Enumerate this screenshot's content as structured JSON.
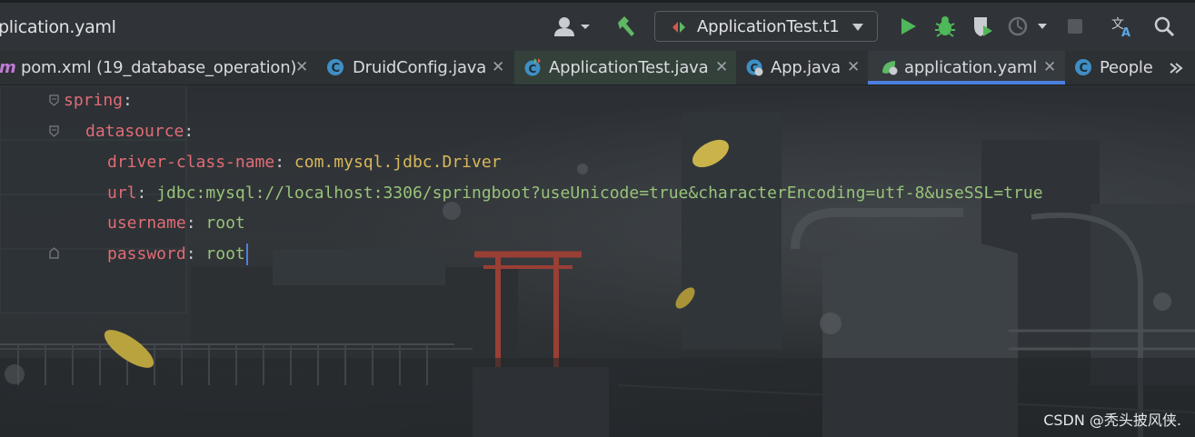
{
  "toolbar": {
    "file_title": "plication.yaml",
    "run_config": "ApplicationTest.t1"
  },
  "tabs": [
    {
      "label": "pom.xml (19_database_operation)",
      "icon": "maven-icon"
    },
    {
      "label": "DruidConfig.java",
      "icon": "class-icon"
    },
    {
      "label": "ApplicationTest.java",
      "icon": "test-class-icon"
    },
    {
      "label": "App.java",
      "icon": "spring-class-icon"
    },
    {
      "label": "application.yaml",
      "icon": "spring-yaml-icon",
      "active": true
    },
    {
      "label": "People",
      "icon": "class-icon"
    }
  ],
  "code": {
    "line1_key": "spring",
    "line2_key": "datasource",
    "line3_key": "driver-class-name",
    "line3_val": "com.mysql.jdbc.Driver",
    "line4_key": "url",
    "line4_val": "jdbc:mysql://localhost:3306/springboot?useUnicode=true&characterEncoding=utf-8&useSSL=true",
    "line5_key": "username",
    "line5_val": "root",
    "line6_key": "password",
    "line6_val": "root"
  },
  "watermark": "CSDN @秃头披风侠.",
  "colors": {
    "key": "#e06c75",
    "value": "#98c379",
    "accent": "#4b7fe0"
  }
}
